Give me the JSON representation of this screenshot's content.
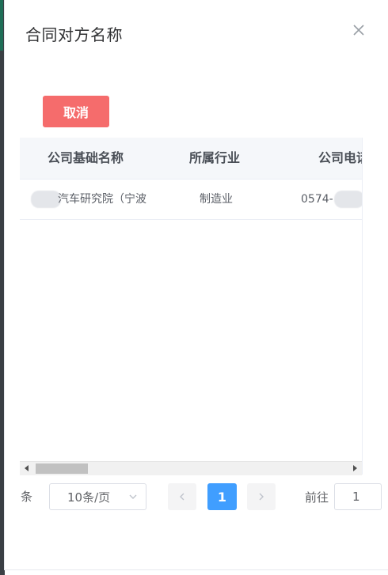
{
  "dialog": {
    "title": "合同对方名称"
  },
  "actions": {
    "cancel_label": "取消"
  },
  "table": {
    "columns": [
      "公司基础名称",
      "所属行业",
      "公司电话"
    ],
    "rows": [
      {
        "name": "汽车研究院（宁波",
        "industry": "制造业",
        "phone": "0574-"
      }
    ]
  },
  "pagination": {
    "total_suffix": "条",
    "page_size": "10条/页",
    "current_page": "1",
    "goto_label": "前往",
    "goto_value": "1"
  },
  "icons": {
    "close": "close-icon",
    "page_size_chevron": "chevron-down-icon",
    "prev": "chevron-left-icon",
    "next": "chevron-right-icon"
  },
  "colors": {
    "danger": "#f56c6c",
    "primary": "#409eff",
    "header_bg": "#f5f7fa"
  }
}
